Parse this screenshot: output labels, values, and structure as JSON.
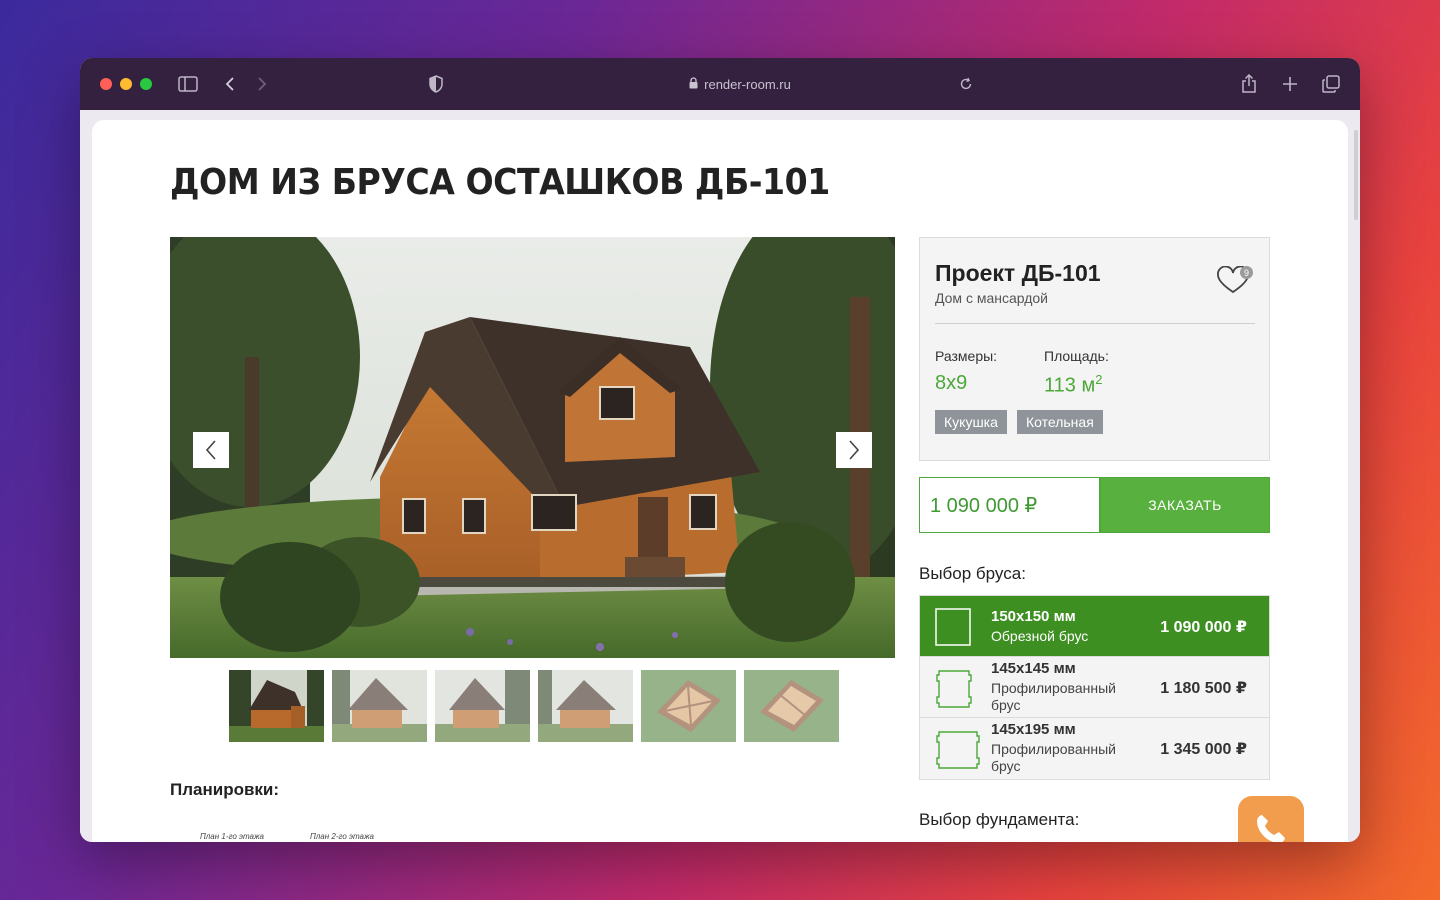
{
  "browser": {
    "url": "render-room.ru",
    "icons": [
      "sidebar-icon",
      "back-icon",
      "forward-icon",
      "shield-icon",
      "lock-icon",
      "reload-icon",
      "share-icon",
      "new-tab-icon",
      "tabs-icon"
    ]
  },
  "page": {
    "title": "ДОМ ИЗ БРУСА ОСТАШКОВ ДБ-101",
    "plans_title": "Планировки:",
    "plan_labels": [
      "План 1-го этажа",
      "План 2-го этажа"
    ],
    "foundation_title": "Выбор фундамента:"
  },
  "card": {
    "project": "Проект ДБ-101",
    "subtitle": "Дом с мансардой",
    "favorites_count": "9",
    "sizes_label": "Размеры:",
    "sizes_value": "8x9",
    "area_label": "Площадь:",
    "area_value": "113 м",
    "area_sup": "2",
    "tags": [
      "Кукушка",
      "Котельная"
    ]
  },
  "order": {
    "price": "1 090 000 ₽",
    "button": "ЗАКАЗАТЬ"
  },
  "beam": {
    "title": "Выбор бруса:",
    "options": [
      {
        "size": "150x150 мм",
        "type": "Обрезной брус",
        "price": "1 090 000 ₽",
        "active": true
      },
      {
        "size": "145x145 мм",
        "type": "Профилированный брус",
        "price": "1 180 500 ₽",
        "active": false
      },
      {
        "size": "145x195 мм",
        "type": "Профилированный брус",
        "price": "1 345 000 ₽",
        "active": false
      }
    ]
  },
  "colors": {
    "accent_green": "#58b03f",
    "dark_green": "#3e8f22",
    "tag_gray": "#8e949a",
    "call_orange": "#f29c4e"
  }
}
